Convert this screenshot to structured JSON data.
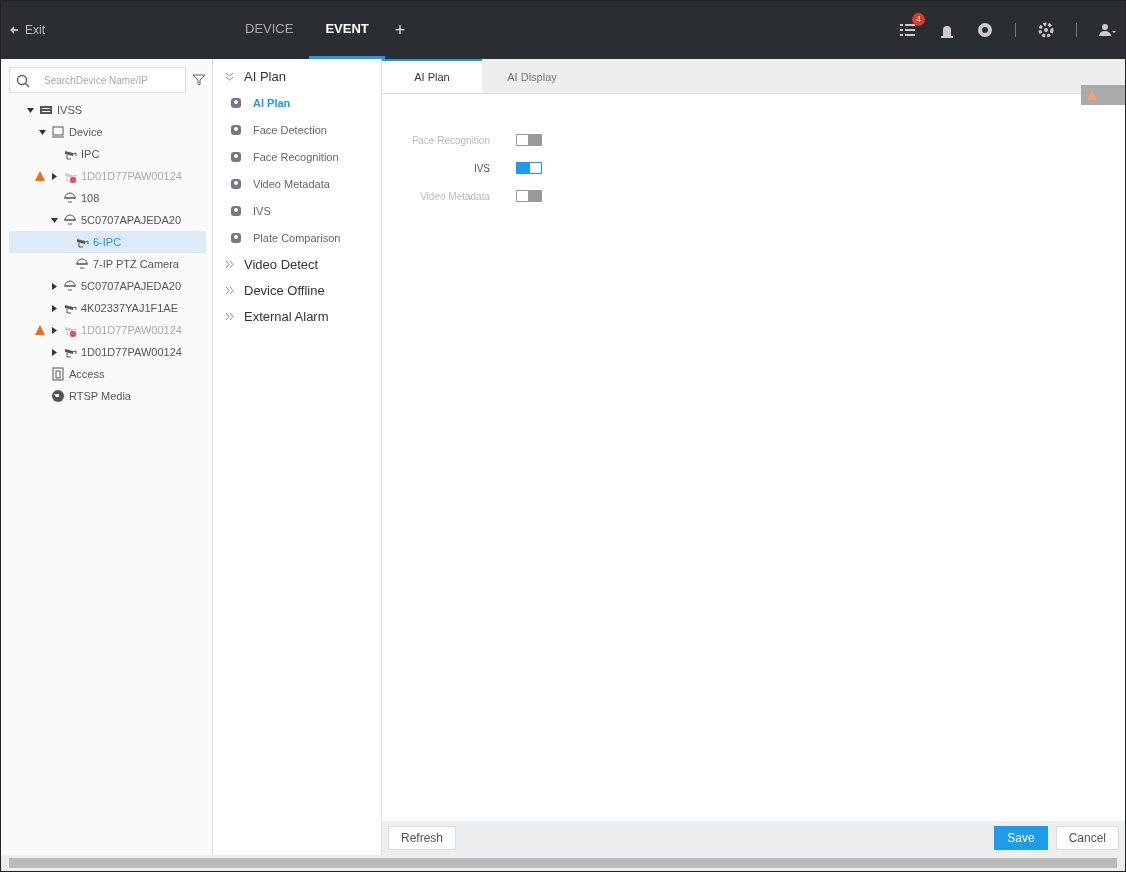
{
  "top_bar": {
    "exit": "Exit",
    "tabs": [
      {
        "label": "DEVICE",
        "selected": false
      },
      {
        "label": "EVENT",
        "selected": true
      }
    ],
    "add": "+",
    "notification_count": "4"
  },
  "search": {
    "placeholder": "SearchDevice Name/IP"
  },
  "tree": [
    {
      "label": "IVSS",
      "kind": "server",
      "expanded": true,
      "selected": false,
      "warning": false,
      "offline": false,
      "children": [
        {
          "label": "Device",
          "kind": "device",
          "expanded": true,
          "selected": false,
          "warning": false,
          "offline": false,
          "children": [
            {
              "label": "IPC",
              "kind": "bullet",
              "selected": false,
              "warning": false,
              "offline": false
            },
            {
              "label": "1D01D77PAW00124",
              "kind": "bullet",
              "expanded": false,
              "selected": false,
              "warning": true,
              "offline": true
            },
            {
              "label": "108",
              "kind": "dome",
              "selected": false,
              "warning": false,
              "offline": false
            },
            {
              "label": "5C0707APAJEDA20",
              "kind": "dome",
              "expanded": true,
              "selected": false,
              "warning": false,
              "offline": false,
              "children": [
                {
                  "label": "6-IPC",
                  "kind": "bullet",
                  "selected": true,
                  "warning": false,
                  "offline": false
                },
                {
                  "label": "7-IP PTZ Camera",
                  "kind": "dome",
                  "selected": false,
                  "warning": false,
                  "offline": false
                }
              ]
            },
            {
              "label": "5C0707APAJEDA20",
              "kind": "dome",
              "expanded": false,
              "selected": false,
              "warning": false,
              "offline": false
            },
            {
              "label": "4K02337YAJ1F1AE",
              "kind": "bullet",
              "expanded": false,
              "selected": false,
              "warning": false,
              "offline": false
            },
            {
              "label": "1D01D77PAW00124",
              "kind": "bullet",
              "expanded": false,
              "selected": false,
              "warning": true,
              "offline": true
            },
            {
              "label": "1D01D77PAW00124",
              "kind": "bullet",
              "expanded": false,
              "selected": false,
              "warning": false,
              "offline": false
            }
          ]
        },
        {
          "label": "Access",
          "kind": "access",
          "selected": false,
          "warning": false,
          "offline": false
        },
        {
          "label": "RTSP Media",
          "kind": "globe",
          "selected": false,
          "warning": false,
          "offline": false
        }
      ]
    }
  ],
  "event_menu": [
    {
      "label": "AI Plan",
      "expanded": true,
      "items": [
        {
          "label": "AI Plan",
          "selected": true
        },
        {
          "label": "Face Detection",
          "selected": false
        },
        {
          "label": "Face Recognition",
          "selected": false
        },
        {
          "label": "Video Metadata",
          "selected": false
        },
        {
          "label": "IVS",
          "selected": false
        },
        {
          "label": "Plate Comparison",
          "selected": false
        }
      ]
    },
    {
      "label": "Video Detect",
      "expanded": false
    },
    {
      "label": "Device Offline",
      "expanded": false
    },
    {
      "label": "External Alarm",
      "expanded": false
    }
  ],
  "content_tabs": [
    {
      "label": "AI Plan",
      "selected": true
    },
    {
      "label": "AI Display",
      "selected": false
    }
  ],
  "toggles": [
    {
      "label": "Face Recognition",
      "on": false,
      "disabled": true
    },
    {
      "label": "IVS",
      "on": true,
      "disabled": false
    },
    {
      "label": "Video Metadata",
      "on": false,
      "disabled": true
    }
  ],
  "buttons": {
    "refresh": "Refresh",
    "save": "Save",
    "cancel": "Cancel"
  }
}
